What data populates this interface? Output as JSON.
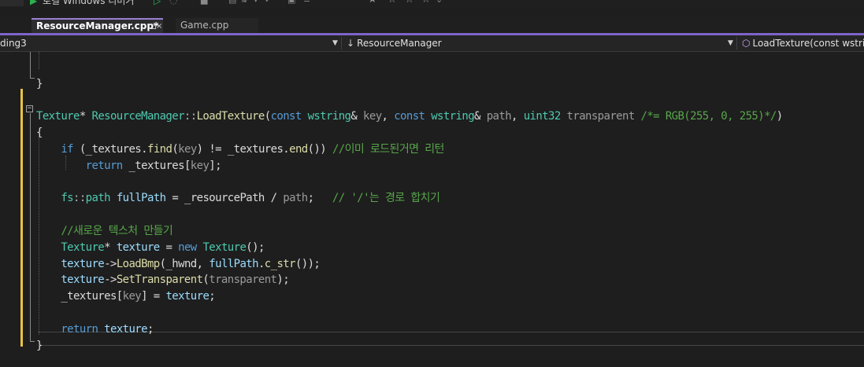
{
  "toolbar": {
    "platform_label": "로컬 Windows 디버거",
    "play_icon": "play-icon",
    "play_outline_icon": "play-no-debug-icon",
    "colors": {
      "play": "#2bb14c"
    }
  },
  "tabs": [
    {
      "label": "ResourceManager.cpp*",
      "pin_glyph": "⊐",
      "close_glyph": "×",
      "active": true
    },
    {
      "label": "Game.cpp",
      "active": false
    }
  ],
  "nav": {
    "project": "ding3",
    "scope": "ResourceManager",
    "member": "LoadTexture(const wstring"
  },
  "editor": {
    "colors": {
      "change_bar": "#e8c344",
      "tab_accent": "#7e63c8"
    },
    "lines": [
      [],
      [
        {
          "t": "}",
          "c": "plain"
        }
      ],
      [],
      [
        {
          "t": "Texture",
          "c": "type"
        },
        {
          "t": "* ",
          "c": "plain"
        },
        {
          "t": "ResourceManager",
          "c": "type"
        },
        {
          "t": "::",
          "c": "op"
        },
        {
          "t": "LoadTexture",
          "c": "fn"
        },
        {
          "t": "(",
          "c": "plain"
        },
        {
          "t": "const",
          "c": "kw"
        },
        {
          "t": " ",
          "c": "plain"
        },
        {
          "t": "wstring",
          "c": "type"
        },
        {
          "t": "& ",
          "c": "plain"
        },
        {
          "t": "key",
          "c": "param"
        },
        {
          "t": ", ",
          "c": "plain"
        },
        {
          "t": "const",
          "c": "kw"
        },
        {
          "t": " ",
          "c": "plain"
        },
        {
          "t": "wstring",
          "c": "type"
        },
        {
          "t": "& ",
          "c": "plain"
        },
        {
          "t": "path",
          "c": "param"
        },
        {
          "t": ", ",
          "c": "plain"
        },
        {
          "t": "uint32",
          "c": "type"
        },
        {
          "t": " ",
          "c": "plain"
        },
        {
          "t": "transparent",
          "c": "param"
        },
        {
          "t": " ",
          "c": "plain"
        },
        {
          "t": "/*= RGB(255, 0, 255)*/",
          "c": "cmt"
        },
        {
          "t": ")",
          "c": "plain"
        }
      ],
      [
        {
          "t": "{",
          "c": "plain"
        }
      ],
      [
        {
          "t": "    ",
          "c": "plain"
        },
        {
          "t": "if",
          "c": "kw"
        },
        {
          "t": " (",
          "c": "plain"
        },
        {
          "t": "_textures",
          "c": "mem"
        },
        {
          "t": ".",
          "c": "plain"
        },
        {
          "t": "find",
          "c": "fn"
        },
        {
          "t": "(",
          "c": "plain"
        },
        {
          "t": "key",
          "c": "param"
        },
        {
          "t": ") != ",
          "c": "plain"
        },
        {
          "t": "_textures",
          "c": "mem"
        },
        {
          "t": ".",
          "c": "plain"
        },
        {
          "t": "end",
          "c": "fn"
        },
        {
          "t": "()) ",
          "c": "plain"
        },
        {
          "t": "//이미 로드된거면 리턴",
          "c": "cmt"
        }
      ],
      [
        {
          "t": "        ",
          "c": "plain"
        },
        {
          "t": "return",
          "c": "kw"
        },
        {
          "t": " ",
          "c": "plain"
        },
        {
          "t": "_textures",
          "c": "mem"
        },
        {
          "t": "[",
          "c": "plain"
        },
        {
          "t": "key",
          "c": "param"
        },
        {
          "t": "];",
          "c": "plain"
        }
      ],
      [],
      [
        {
          "t": "    ",
          "c": "plain"
        },
        {
          "t": "fs",
          "c": "ns"
        },
        {
          "t": "::",
          "c": "op"
        },
        {
          "t": "path",
          "c": "type"
        },
        {
          "t": " ",
          "c": "plain"
        },
        {
          "t": "fullPath",
          "c": "var"
        },
        {
          "t": " = ",
          "c": "plain"
        },
        {
          "t": "_resourcePath",
          "c": "mem"
        },
        {
          "t": " / ",
          "c": "plain"
        },
        {
          "t": "path",
          "c": "param"
        },
        {
          "t": ";   ",
          "c": "plain"
        },
        {
          "t": "// '/'는 경로 합치기",
          "c": "cmt"
        }
      ],
      [],
      [
        {
          "t": "    ",
          "c": "plain"
        },
        {
          "t": "//새로운 텍스처 만들기",
          "c": "cmt"
        }
      ],
      [
        {
          "t": "    ",
          "c": "plain"
        },
        {
          "t": "Texture",
          "c": "type"
        },
        {
          "t": "* ",
          "c": "plain"
        },
        {
          "t": "texture",
          "c": "var"
        },
        {
          "t": " = ",
          "c": "plain"
        },
        {
          "t": "new",
          "c": "kw"
        },
        {
          "t": " ",
          "c": "plain"
        },
        {
          "t": "Texture",
          "c": "type"
        },
        {
          "t": "();",
          "c": "plain"
        }
      ],
      [
        {
          "t": "    ",
          "c": "plain"
        },
        {
          "t": "texture",
          "c": "var"
        },
        {
          "t": "->",
          "c": "plain"
        },
        {
          "t": "LoadBmp",
          "c": "fn"
        },
        {
          "t": "(",
          "c": "plain"
        },
        {
          "t": "_hwnd",
          "c": "mem"
        },
        {
          "t": ", ",
          "c": "plain"
        },
        {
          "t": "fullPath",
          "c": "var"
        },
        {
          "t": ".",
          "c": "plain"
        },
        {
          "t": "c_str",
          "c": "fn"
        },
        {
          "t": "());",
          "c": "plain"
        }
      ],
      [
        {
          "t": "    ",
          "c": "plain"
        },
        {
          "t": "texture",
          "c": "var"
        },
        {
          "t": "->",
          "c": "plain"
        },
        {
          "t": "SetTransparent",
          "c": "fn"
        },
        {
          "t": "(",
          "c": "plain"
        },
        {
          "t": "transparent",
          "c": "param"
        },
        {
          "t": ");",
          "c": "plain"
        }
      ],
      [
        {
          "t": "    ",
          "c": "plain"
        },
        {
          "t": "_textures",
          "c": "mem"
        },
        {
          "t": "[",
          "c": "plain"
        },
        {
          "t": "key",
          "c": "param"
        },
        {
          "t": "] = ",
          "c": "plain"
        },
        {
          "t": "texture",
          "c": "var"
        },
        {
          "t": ";",
          "c": "plain"
        }
      ],
      [],
      [
        {
          "t": "    ",
          "c": "plain"
        },
        {
          "t": "return",
          "c": "kw"
        },
        {
          "t": " ",
          "c": "plain"
        },
        {
          "t": "texture",
          "c": "var"
        },
        {
          "t": ";",
          "c": "plain"
        }
      ],
      [
        {
          "t": "}",
          "c": "plain"
        }
      ]
    ]
  }
}
